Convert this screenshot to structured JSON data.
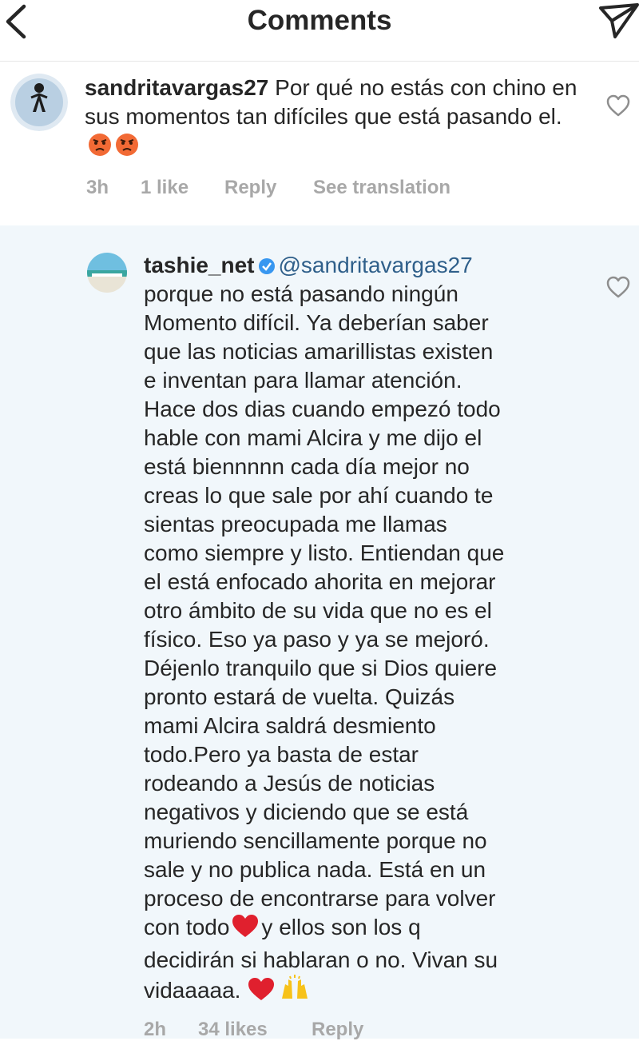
{
  "header": {
    "title": "Comments",
    "back_icon": "chevron-left-icon",
    "send_icon": "paper-plane-icon"
  },
  "comment": {
    "username": "sandritavargas27",
    "text": "Por qué no estás con chino en sus momentos tan difíciles que está pasando el.",
    "emoji": "angry-face-emoji",
    "time": "3h",
    "likes": "1 like",
    "reply_label": "Reply",
    "translate_label": "See translation"
  },
  "reply": {
    "username": "tashie_net",
    "mention": "@sandritavargas27",
    "lines": [
      "porque no está pasando ningún",
      "Momento difícil. Ya deberían saber",
      "que las noticias amarillistas existen",
      "e inventan para llamar atención.",
      "Hace dos dias cuando empezó todo",
      "hable con mami Alcira y me dijo el",
      "está biennnnn cada día mejor no",
      "creas lo que sale por ahí cuando te",
      "sientas preocupada me llamas",
      "como siempre y listo. Entiendan que",
      "el está enfocado ahorita en mejorar",
      "otro ámbito de su vida que no es el",
      "físico. Eso ya paso y ya se mejoró.",
      "Déjenlo tranquilo que si Dios quiere",
      "pronto estará de vuelta. Quizás",
      "mami Alcira saldrá desmiento",
      "todo.Pero ya basta de estar",
      "rodeando a Jesús de noticias",
      "negativos y diciendo que se está",
      "muriendo sencillamente porque no",
      "sale y no publica nada. Está en un",
      "proceso de encontrarse para volver"
    ],
    "line_22a": "con todo",
    "line_22b": "y ellos son los q",
    "line_23": "decidirán si hablaran o no. Vivan su",
    "line_24": "vidaaaaa.",
    "heart_emoji": "red-heart-emoji",
    "hands_emoji": "raising-hands-emoji",
    "time": "2h",
    "likes": "34 likes",
    "reply_label": "Reply"
  },
  "colors": {
    "text": "#262626",
    "meta": "#a8a8a8",
    "mention": "#2f5f8a",
    "verified": "#3897f0",
    "reply_bg": "#f1f7fb"
  }
}
